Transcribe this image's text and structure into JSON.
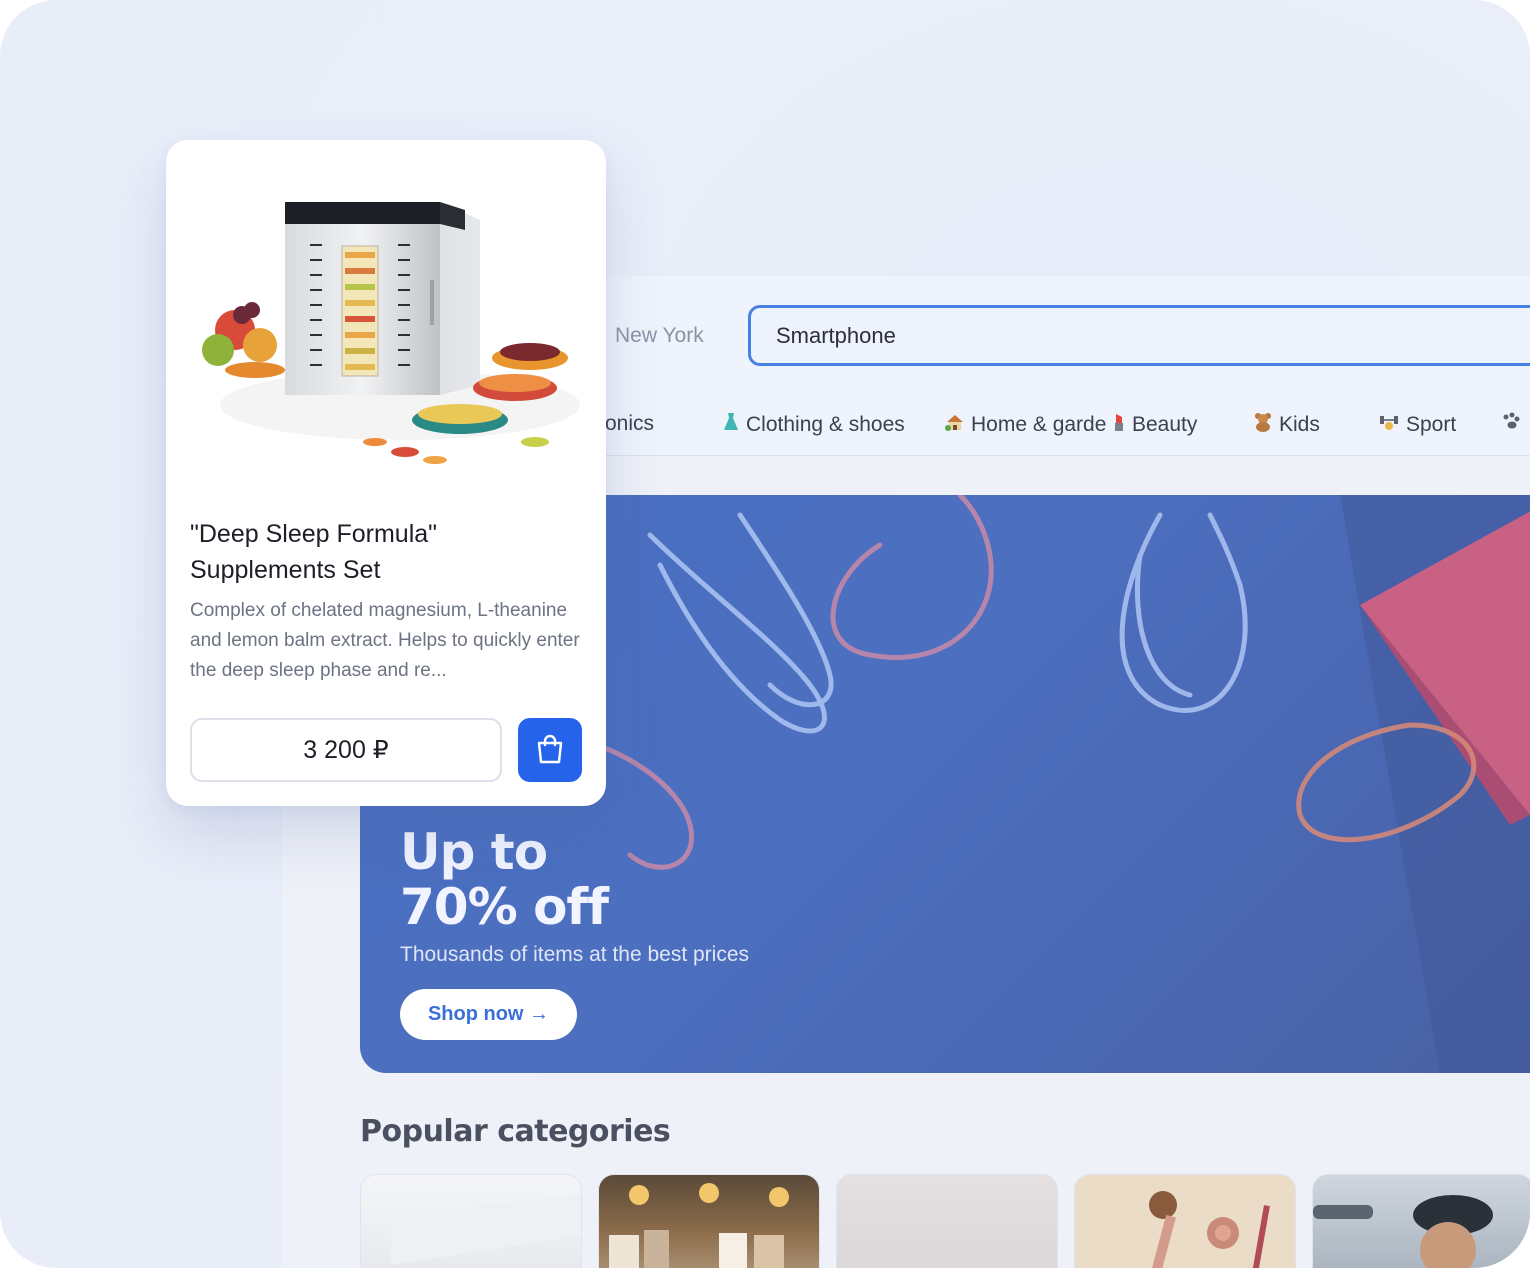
{
  "header": {
    "city": "New York",
    "search_value": "Smartphone"
  },
  "categories_nav": [
    {
      "label": "ronics",
      "icon": "electronics-icon"
    },
    {
      "label": "Clothing & shoes",
      "icon": "dress-icon"
    },
    {
      "label": "Home & garde",
      "icon": "house-icon"
    },
    {
      "label": "Beauty",
      "icon": "lipstick-icon"
    },
    {
      "label": "Kids",
      "icon": "teddy-bear-icon"
    },
    {
      "label": "Sport",
      "icon": "dumbbell-icon"
    },
    {
      "label": "",
      "icon": "paw-icon"
    }
  ],
  "banner": {
    "title_line1": "Up to",
    "title_line2": "70% off",
    "subtitle": "Thousands of items at the best prices",
    "cta": "Shop now →"
  },
  "popular": {
    "title": "Popular categories"
  },
  "product": {
    "title": "\"Deep Sleep Formula\" Supplements Set",
    "description": "Complex of chelated magnesium, L-theanine and lemon balm extract. Helps to quickly enter the deep sleep phase and re...",
    "price": "3 200 ₽",
    "cart_icon": "shopping-bag-icon"
  },
  "colors": {
    "accent": "#2563eb",
    "banner": "#4a6fc2",
    "search_border": "#4a80e3"
  }
}
